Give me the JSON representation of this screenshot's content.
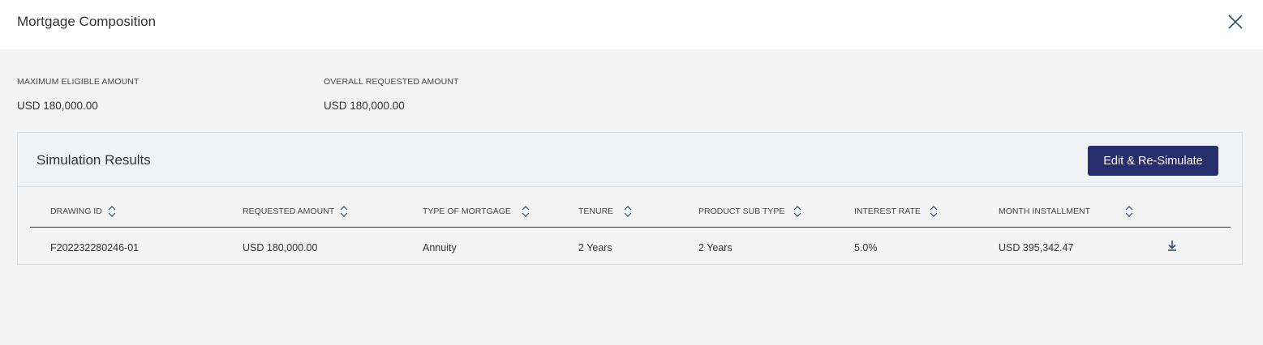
{
  "modal": {
    "title": "Mortgage Composition"
  },
  "summary": {
    "max_eligible_label": "MAXIMUM ELIGIBLE AMOUNT",
    "max_eligible_value": "USD 180,000.00",
    "overall_requested_label": "OVERALL REQUESTED AMOUNT",
    "overall_requested_value": "USD 180,000.00"
  },
  "simulation": {
    "title": "Simulation Results",
    "button_label": "Edit & Re-Simulate",
    "columns": [
      "DRAWING ID",
      "REQUESTED AMOUNT",
      "TYPE OF MORTGAGE",
      "TENURE",
      "PRODUCT SUB TYPE",
      "INTEREST RATE",
      "MONTH INSTALLMENT"
    ],
    "rows": [
      {
        "drawing_id": "F202232280246-01",
        "requested_amount": "USD 180,000.00",
        "type_of_mortgage": "Annuity",
        "tenure": "2 Years",
        "product_sub_type": "2 Years",
        "interest_rate": "5.0%",
        "month_installment": "USD 395,342.47"
      }
    ]
  },
  "icons": {
    "close": "close-icon",
    "sort": "sort-icon",
    "download": "download-icon"
  },
  "colors": {
    "primary": "#262e6b",
    "icon": "#2a4a6e",
    "header_bg": "#eff3f6",
    "page_bg": "#f4f4f4"
  }
}
